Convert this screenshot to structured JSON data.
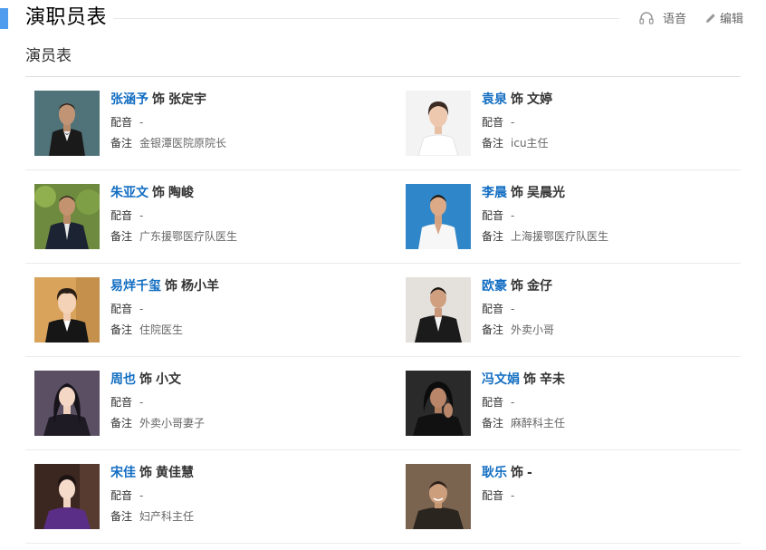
{
  "header": {
    "title": "演职员表",
    "voice_label": "语音",
    "edit_label": "编辑",
    "accent_color": "#4f9cee"
  },
  "subtitle": "演员表",
  "labels": {
    "role_sep": "饰",
    "dub": "配音",
    "note": "备注"
  },
  "cast": [
    {
      "actor": "张涵予",
      "role": "张定宇",
      "dub": "-",
      "note": "金银潭医院原院长"
    },
    {
      "actor": "袁泉",
      "role": "文婷",
      "dub": "-",
      "note": "icu主任"
    },
    {
      "actor": "朱亚文",
      "role": "陶峻",
      "dub": "-",
      "note": "广东援鄂医疗队医生"
    },
    {
      "actor": "李晨",
      "role": "吴晨光",
      "dub": "-",
      "note": "上海援鄂医疗队医生"
    },
    {
      "actor": "易烊千玺",
      "role": "杨小羊",
      "dub": "-",
      "note": "住院医生"
    },
    {
      "actor": "欧豪",
      "role": "金仔",
      "dub": "-",
      "note": "外卖小哥"
    },
    {
      "actor": "周也",
      "role": "小文",
      "dub": "-",
      "note": "外卖小哥妻子"
    },
    {
      "actor": "冯文娟",
      "role": "辛未",
      "dub": "-",
      "note": "麻醉科主任"
    },
    {
      "actor": "宋佳",
      "role": "黄佳慧",
      "dub": "-",
      "note": "妇产科主任"
    },
    {
      "actor": "耿乐",
      "role": "-",
      "dub": "-",
      "note": null
    }
  ],
  "colors": {
    "link": "#136ec2",
    "text": "#333333",
    "muted": "#666666"
  }
}
